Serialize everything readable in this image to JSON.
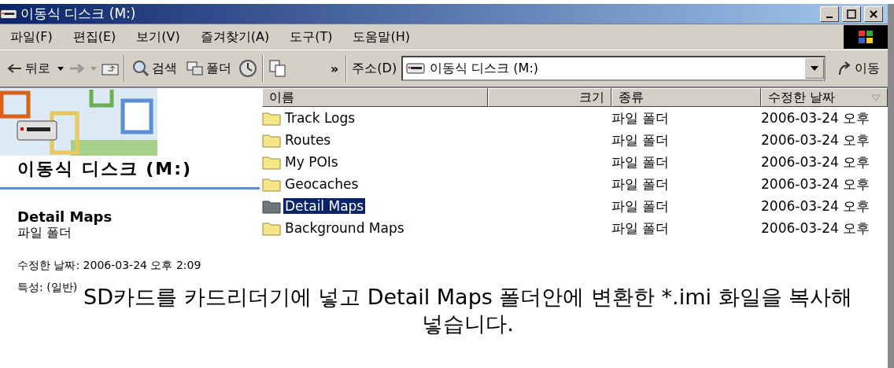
{
  "window": {
    "title": "이동식 디스크 (M:)"
  },
  "menu": [
    "파일(F)",
    "편집(E)",
    "보기(V)",
    "즐겨찾기(A)",
    "도구(T)",
    "도움말(H)"
  ],
  "toolbar": {
    "back": "뒤로",
    "search": "검색",
    "folders": "폴더",
    "more": "»",
    "address_label": "주소(D)",
    "address": "이동식 디스크 (M:)",
    "go": "이동"
  },
  "info_panel": {
    "heading": "이동식 디스크 (M:)",
    "name": "Detail Maps",
    "type": "파일 폴더",
    "modified": "수정한 날짜: 2006-03-24 오후 2:09",
    "attributes": "특성: (일반)"
  },
  "columns": [
    "이름",
    "크기",
    "종류",
    "수정한 날짜"
  ],
  "rows": [
    {
      "name": "Track Logs",
      "type": "파일 폴더",
      "modified": "2006-03-24 오후",
      "selected": false
    },
    {
      "name": "Routes",
      "type": "파일 폴더",
      "modified": "2006-03-24 오후",
      "selected": false
    },
    {
      "name": "My POIs",
      "type": "파일 폴더",
      "modified": "2006-03-24 오후",
      "selected": false
    },
    {
      "name": "Geocaches",
      "type": "파일 폴더",
      "modified": "2006-03-24 오후",
      "selected": false
    },
    {
      "name": "Detail Maps",
      "type": "파일 폴더",
      "modified": "2006-03-24 오후",
      "selected": true
    },
    {
      "name": "Background Maps",
      "type": "파일 폴더",
      "modified": "2006-03-24 오후",
      "selected": false
    }
  ],
  "annotation": "SD카드를 카드리더기에 넣고 Detail Maps 폴더안에 변환한 *.imi 화일을 복사해 넣습니다."
}
